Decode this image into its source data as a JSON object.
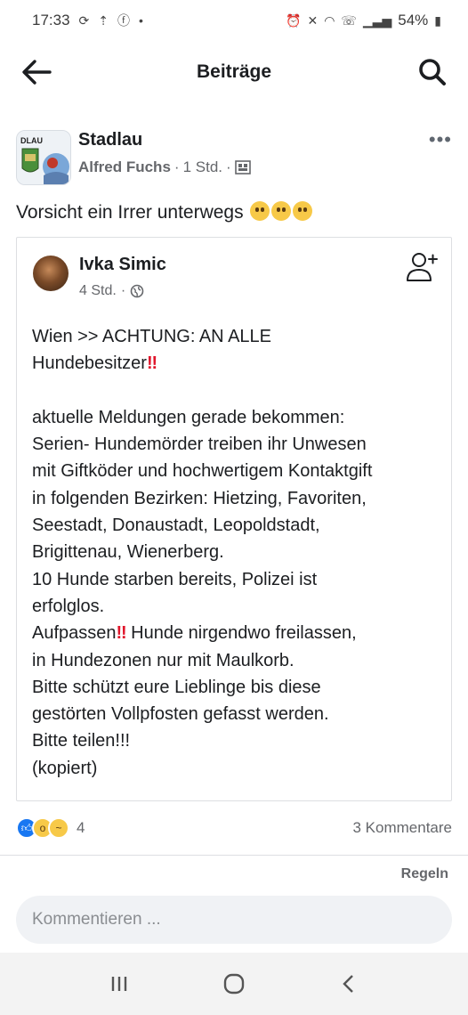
{
  "status_bar": {
    "time": "17:33",
    "battery": "54%"
  },
  "app_bar": {
    "title": "Beiträge"
  },
  "post": {
    "group_name": "Stadlau",
    "group_avatar_text": "DLAU",
    "author": "Alfred Fuchs",
    "time": "1 Std.",
    "text": "Vorsicht ein Irrer unterwegs"
  },
  "shared_post": {
    "author": "Ivka Simic",
    "time": "4 Std.",
    "lines": [
      "Wien >> ACHTUNG: AN ALLE",
      "Hundebesitzer",
      "",
      "aktuelle Meldungen gerade bekommen:",
      "Serien- Hundemörder treiben ihr Unwesen",
      "mit Giftköder und hochwertigem Kontaktgift",
      "in folgenden Bezirken: Hietzing, Favoriten,",
      "Seestadt, Donaustadt, Leopoldstadt,",
      "Brigittenau, Wienerberg.",
      "10 Hunde starben bereits, Polizei ist",
      "erfolglos.",
      "Aufpassen",
      "Hunde nirgendwo freilassen,",
      "in Hundezonen nur mit Maulkorb.",
      "Bitte schützt eure Lieblinge bis diese",
      "gestörten Vollpfosten gefasst werden.",
      "Bitte teilen!!!",
      "(kopiert)"
    ],
    "bang": "‼"
  },
  "reactions": {
    "count": "4",
    "comments": "3 Kommentare"
  },
  "rules_label": "Regeln",
  "comment_placeholder": "Kommentieren ...",
  "colors": {
    "accent": "#1877f2",
    "bang": "#e0162b",
    "muted": "#65676b"
  }
}
